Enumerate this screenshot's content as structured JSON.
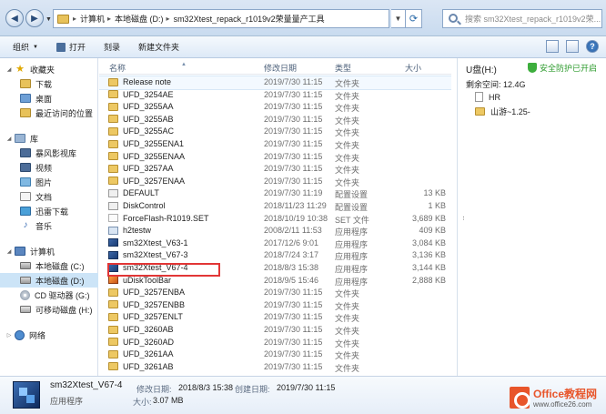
{
  "address_bar": {
    "crumbs": [
      "计算机",
      "本地磁盘 (D:)",
      "sm32Xtest_repack_r1019v2荣量量产工具"
    ],
    "search_placeholder": "搜索 sm32Xtest_repack_r1019v2荣..."
  },
  "toolbar": {
    "organize_label": "组织",
    "open_label": "打开",
    "burn_label": "刻录",
    "new_folder_label": "新建文件夹"
  },
  "nav": {
    "favorites_label": "收藏夹",
    "favorites": [
      "下载",
      "桌面",
      "最近访问的位置"
    ],
    "library_label": "库",
    "libraries": [
      "暴风影视库",
      "视频",
      "图片",
      "文档",
      "迅雷下载",
      "音乐"
    ],
    "computer_label": "计算机",
    "drives": [
      "本地磁盘 (C:)",
      "本地磁盘 (D:)",
      "CD 驱动器 (G:)",
      "可移动磁盘 (H:)"
    ],
    "network_label": "网络"
  },
  "columns": {
    "name": "名称",
    "date": "修改日期",
    "type": "类型",
    "size": "大小"
  },
  "files": [
    {
      "name": "Release note",
      "date": "2019/7/30 11:15",
      "type": "文件夹",
      "size": "",
      "icon": "folder"
    },
    {
      "name": "UFD_3254AE",
      "date": "2019/7/30 11:15",
      "type": "文件夹",
      "size": "",
      "icon": "folder"
    },
    {
      "name": "UFD_3255AA",
      "date": "2019/7/30 11:15",
      "type": "文件夹",
      "size": "",
      "icon": "folder"
    },
    {
      "name": "UFD_3255AB",
      "date": "2019/7/30 11:15",
      "type": "文件夹",
      "size": "",
      "icon": "folder"
    },
    {
      "name": "UFD_3255AC",
      "date": "2019/7/30 11:15",
      "type": "文件夹",
      "size": "",
      "icon": "folder"
    },
    {
      "name": "UFD_3255ENA1",
      "date": "2019/7/30 11:15",
      "type": "文件夹",
      "size": "",
      "icon": "folder"
    },
    {
      "name": "UFD_3255ENAA",
      "date": "2019/7/30 11:15",
      "type": "文件夹",
      "size": "",
      "icon": "folder"
    },
    {
      "name": "UFD_3257AA",
      "date": "2019/7/30 11:15",
      "type": "文件夹",
      "size": "",
      "icon": "folder"
    },
    {
      "name": "UFD_3257ENAA",
      "date": "2019/7/30 11:15",
      "type": "文件夹",
      "size": "",
      "icon": "folder"
    },
    {
      "name": "DEFAULT",
      "date": "2019/7/30 11:19",
      "type": "配置设置",
      "size": "13 KB",
      "icon": "cfg"
    },
    {
      "name": "DiskControl",
      "date": "2018/11/23 11:29",
      "type": "配置设置",
      "size": "1 KB",
      "icon": "cfg"
    },
    {
      "name": "ForceFlash-R1019.SET",
      "date": "2018/10/19 10:38",
      "type": "SET 文件",
      "size": "3,689 KB",
      "icon": "set"
    },
    {
      "name": "h2testw",
      "date": "2008/2/11 11:53",
      "type": "应用程序",
      "size": "409 KB",
      "icon": "app"
    },
    {
      "name": "sm32Xtest_V63-1",
      "date": "2017/12/6 9:01",
      "type": "应用程序",
      "size": "3,084 KB",
      "icon": "exe"
    },
    {
      "name": "sm32Xtest_V67-3",
      "date": "2018/7/24 3:17",
      "type": "应用程序",
      "size": "3,136 KB",
      "icon": "exe"
    },
    {
      "name": "sm32Xtest_V67-4",
      "date": "2018/8/3 15:38",
      "type": "应用程序",
      "size": "3,144 KB",
      "icon": "exe"
    },
    {
      "name": "uDiskToolBar",
      "date": "2018/9/5 15:46",
      "type": "应用程序",
      "size": "2,888 KB",
      "icon": "tool"
    },
    {
      "name": "UFD_3257ENBA",
      "date": "2019/7/30 11:15",
      "type": "文件夹",
      "size": "",
      "icon": "folder"
    },
    {
      "name": "UFD_3257ENBB",
      "date": "2019/7/30 11:15",
      "type": "文件夹",
      "size": "",
      "icon": "folder"
    },
    {
      "name": "UFD_3257ENLT",
      "date": "2019/7/30 11:15",
      "type": "文件夹",
      "size": "",
      "icon": "folder"
    },
    {
      "name": "UFD_3260AB",
      "date": "2019/7/30 11:15",
      "type": "文件夹",
      "size": "",
      "icon": "folder"
    },
    {
      "name": "UFD_3260AD",
      "date": "2019/7/30 11:15",
      "type": "文件夹",
      "size": "",
      "icon": "folder"
    },
    {
      "name": "UFD_3261AA",
      "date": "2019/7/30 11:15",
      "type": "文件夹",
      "size": "",
      "icon": "folder"
    },
    {
      "name": "UFD_3261AB",
      "date": "2019/7/30 11:15",
      "type": "文件夹",
      "size": "",
      "icon": "folder"
    }
  ],
  "preview": {
    "title": "U盘(H:)",
    "safe_label": "安全防护已开启",
    "free_space": "剩余空间: 12.4G",
    "items": [
      "HR",
      "山游~1.25-"
    ]
  },
  "details": {
    "name": "sm32Xtest_V67-4",
    "type": "应用程序",
    "modified_key": "修改日期:",
    "modified_val": "2018/8/3 15:38",
    "size_key": "大小:",
    "size_val": "3.07 MB",
    "created_key": "创建日期:",
    "created_val": "2019/7/30 11:15"
  },
  "watermark": {
    "line1": "Office教程网",
    "line2": "www.office26.com"
  },
  "colors": {
    "highlight_box": "#e23636",
    "safe_green": "#2d9b2d",
    "watermark_orange": "#e8552a"
  }
}
